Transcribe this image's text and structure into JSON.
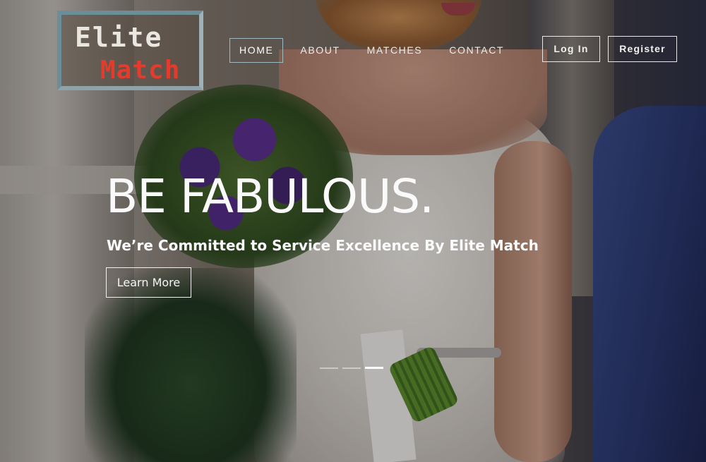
{
  "logo": {
    "line1": "Elite",
    "line2": "Match"
  },
  "nav": {
    "items": [
      {
        "label": "HOME",
        "active": true
      },
      {
        "label": "ABOUT",
        "active": false
      },
      {
        "label": "MATCHES",
        "active": false
      },
      {
        "label": "CONTACT",
        "active": false
      }
    ]
  },
  "auth": {
    "login_label": "Log In",
    "register_label": "Register"
  },
  "hero": {
    "headline": "BE FABULOUS.",
    "subline": "We’re Committed to Service Excellence By Elite Match",
    "cta_label": "Learn More"
  },
  "carousel": {
    "slide_count": 3,
    "active_index": 2
  },
  "colors": {
    "logo_accent": "#e43b2c",
    "logo_border": "#6c8e99",
    "active_nav_border": "#9fb9c3"
  }
}
